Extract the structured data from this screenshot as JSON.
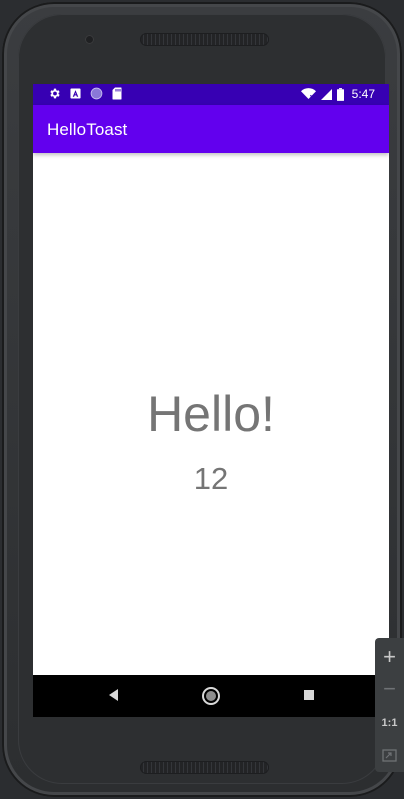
{
  "status_bar": {
    "time": "5:47",
    "left_icons": [
      "gear-icon",
      "a-icon",
      "circle-icon",
      "sd-card-icon"
    ],
    "right_icons": [
      "wifi-icon",
      "signal-icon",
      "battery-icon"
    ]
  },
  "app_bar": {
    "title": "HelloToast"
  },
  "main": {
    "greeting": "Hello!",
    "count": "12"
  },
  "nav_bar": {
    "buttons": [
      "back-icon",
      "home-icon",
      "recents-icon"
    ]
  },
  "emulator_toolbar": {
    "zoom_in": "+",
    "zoom_out": "−",
    "actual_size": "1:1"
  },
  "colors": {
    "status_bar": "#3700b3",
    "app_bar": "#6200ee",
    "text_gray": "#757575",
    "nav_bar": "#000000"
  }
}
